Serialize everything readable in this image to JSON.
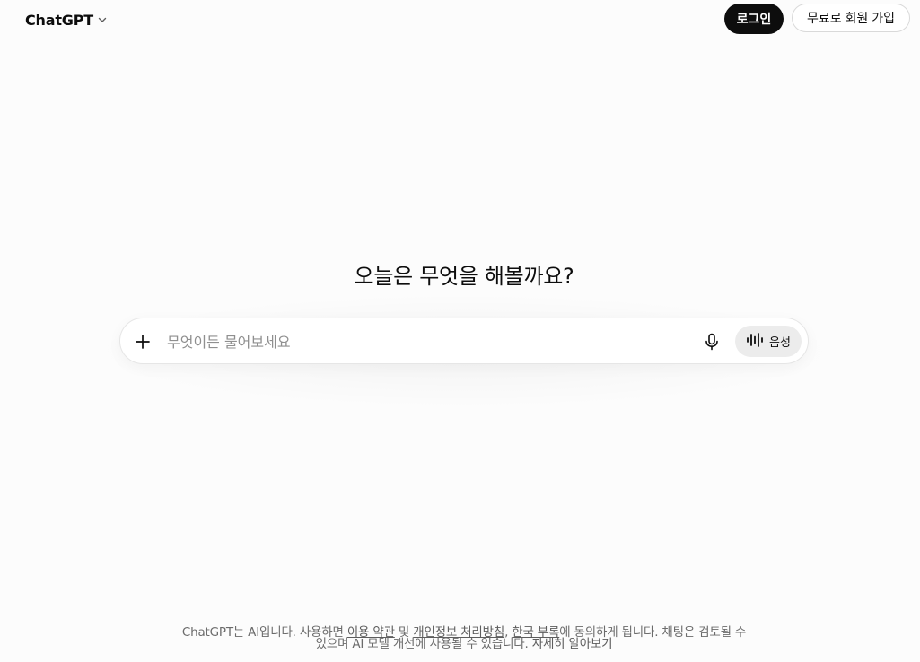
{
  "header": {
    "model_name": "ChatGPT",
    "login_label": "로그인",
    "signup_label": "무료로 회원 가입"
  },
  "main": {
    "heading": "오늘은 무엇을 해볼까요?",
    "composer": {
      "placeholder": "무엇이든 물어보세요",
      "plus_icon": "plus-icon",
      "mic_icon": "mic-icon",
      "voice_icon": "voice-waveform-icon",
      "voice_label": "음성"
    }
  },
  "footer": {
    "text_1": "ChatGPT는 AI입니다. 사용하면 ",
    "terms_link": "이용 약관",
    "text_2": " 및 ",
    "privacy_link": "개인정보 처리방침",
    "text_3": ", ",
    "appendix_link": "한국 부록",
    "text_4": "에 동의하게 됩니다. 채팅은 검토될 수 있으며 AI 모델 개선에 사용될 수 있습니다. ",
    "learn_more_link": "자세히 알아보기"
  },
  "colors": {
    "background": "#fcfcfc",
    "primary_button": "#0d0d0d",
    "voice_button": "#ececec",
    "footer_text": "#6b6b6b"
  }
}
